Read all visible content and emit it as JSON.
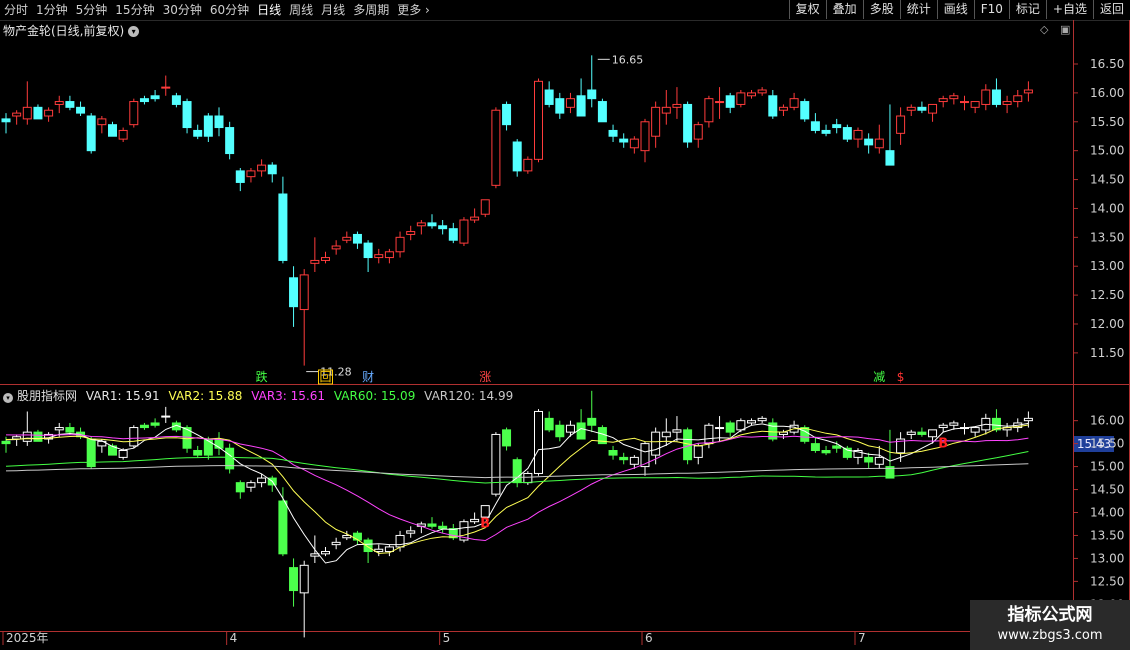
{
  "toolbar": {
    "periods": [
      "分时",
      "1分钟",
      "5分钟",
      "15分钟",
      "30分钟",
      "60分钟",
      "日线",
      "周线",
      "月线",
      "多周期"
    ],
    "active_period": "日线",
    "more": "更多",
    "tools": [
      "复权",
      "叠加",
      "多股",
      "统计",
      "画线",
      "F10",
      "标记",
      "+自选",
      "返回"
    ]
  },
  "stock": {
    "title": "物产金轮(日线,前复权)"
  },
  "indicator": {
    "name": "股朋指标网",
    "var1_label": "VAR1: 15.91",
    "var2_label": "VAR2: 15.88",
    "var3_label": "VAR3: 15.61",
    "var60_label": "VAR60: 15.09",
    "var120_label": "VAR120: 14.99",
    "current_price_tag": "15.43"
  },
  "colors": {
    "up": "#ff3c3c",
    "down": "#54ffff",
    "ind_up": "#ffffff",
    "ind_down": "#4cff4c",
    "var1": "#ffffff",
    "var2": "#ffff55",
    "var3": "#ff44ff",
    "var60": "#44ff44",
    "var120": "#c8c8c8",
    "axis": "#b03030",
    "signal": "#ff2020"
  },
  "watermark": {
    "title": "指标公式网",
    "url": "www.zbgs3.com"
  },
  "chart_data": [
    {
      "type": "candlestick",
      "title": "物产金轮(日线,前复权)",
      "y_ticks": [
        16.5,
        16.0,
        15.5,
        15.0,
        14.5,
        14.0,
        13.5,
        13.0,
        12.5,
        12.0,
        11.5
      ],
      "ylim": [
        11.1,
        16.95
      ],
      "annotations": {
        "high_label": "16.65",
        "low_label": "11.28"
      },
      "event_markers": [
        {
          "index": 24,
          "label": "跌",
          "color": "#44ff44"
        },
        {
          "index": 30,
          "label": "回",
          "color": "#ffcc00",
          "boxed": true
        },
        {
          "index": 34,
          "label": "财",
          "color": "#66aaff"
        },
        {
          "index": 45,
          "label": "涨",
          "color": "#ff4444"
        },
        {
          "index": 82,
          "label": "减",
          "color": "#44ff44"
        },
        {
          "index": 84,
          "label": "$",
          "color": "#ff3333"
        }
      ],
      "candles": [
        [
          15.55,
          15.65,
          15.3,
          15.5
        ],
        [
          15.6,
          15.7,
          15.45,
          15.65
        ],
        [
          15.55,
          16.2,
          15.45,
          15.75
        ],
        [
          15.75,
          15.8,
          15.55,
          15.55
        ],
        [
          15.6,
          15.75,
          15.5,
          15.7
        ],
        [
          15.8,
          15.95,
          15.65,
          15.85
        ],
        [
          15.85,
          15.95,
          15.7,
          15.75
        ],
        [
          15.75,
          15.85,
          15.6,
          15.65
        ],
        [
          15.6,
          15.65,
          14.95,
          15.0
        ],
        [
          15.45,
          15.6,
          15.3,
          15.55
        ],
        [
          15.45,
          15.5,
          15.25,
          15.25
        ],
        [
          15.2,
          15.4,
          15.15,
          15.35
        ],
        [
          15.45,
          15.9,
          15.4,
          15.85
        ],
        [
          15.9,
          15.95,
          15.8,
          15.85
        ],
        [
          15.95,
          16.05,
          15.85,
          15.9
        ],
        [
          16.1,
          16.3,
          15.95,
          16.1
        ],
        [
          15.95,
          16.0,
          15.75,
          15.8
        ],
        [
          15.85,
          15.9,
          15.3,
          15.4
        ],
        [
          15.35,
          15.45,
          15.2,
          15.25
        ],
        [
          15.6,
          15.65,
          15.15,
          15.25
        ],
        [
          15.6,
          15.75,
          15.25,
          15.4
        ],
        [
          15.4,
          15.5,
          14.85,
          14.95
        ],
        [
          14.65,
          14.7,
          14.3,
          14.45
        ],
        [
          14.55,
          14.7,
          14.45,
          14.65
        ],
        [
          14.65,
          14.85,
          14.55,
          14.75
        ],
        [
          14.75,
          14.8,
          14.45,
          14.6
        ],
        [
          14.25,
          14.55,
          13.05,
          13.1
        ],
        [
          12.8,
          13.0,
          11.95,
          12.3
        ],
        [
          12.25,
          12.95,
          11.28,
          12.85
        ],
        [
          13.05,
          13.5,
          12.9,
          13.1
        ],
        [
          13.1,
          13.25,
          13.05,
          13.15
        ],
        [
          13.3,
          13.45,
          13.2,
          13.35
        ],
        [
          13.45,
          13.6,
          13.4,
          13.5
        ],
        [
          13.55,
          13.6,
          13.3,
          13.4
        ],
        [
          13.4,
          13.45,
          12.9,
          13.15
        ],
        [
          13.15,
          13.3,
          13.05,
          13.2
        ],
        [
          13.15,
          13.3,
          13.05,
          13.25
        ],
        [
          13.25,
          13.6,
          13.15,
          13.5
        ],
        [
          13.55,
          13.7,
          13.45,
          13.6
        ],
        [
          13.7,
          13.8,
          13.55,
          13.75
        ],
        [
          13.75,
          13.9,
          13.65,
          13.7
        ],
        [
          13.7,
          13.8,
          13.55,
          13.65
        ],
        [
          13.65,
          13.75,
          13.4,
          13.45
        ],
        [
          13.4,
          13.85,
          13.35,
          13.8
        ],
        [
          13.8,
          14.0,
          13.75,
          13.85
        ],
        [
          13.9,
          14.15,
          13.85,
          14.15
        ],
        [
          14.4,
          15.75,
          14.35,
          15.7
        ],
        [
          15.8,
          15.85,
          15.35,
          15.45
        ],
        [
          15.15,
          15.2,
          14.55,
          14.65
        ],
        [
          14.65,
          14.9,
          14.6,
          14.85
        ],
        [
          14.85,
          16.25,
          14.8,
          16.2
        ],
        [
          16.05,
          16.2,
          15.75,
          15.8
        ],
        [
          15.9,
          16.0,
          15.55,
          15.65
        ],
        [
          15.75,
          16.0,
          15.65,
          15.9
        ],
        [
          15.95,
          16.25,
          15.7,
          15.6
        ],
        [
          16.05,
          16.65,
          15.75,
          15.9
        ],
        [
          15.85,
          15.9,
          15.55,
          15.5
        ],
        [
          15.35,
          15.45,
          15.15,
          15.25
        ],
        [
          15.2,
          15.3,
          15.05,
          15.15
        ],
        [
          15.05,
          15.25,
          14.95,
          15.2
        ],
        [
          15.0,
          15.55,
          14.8,
          15.5
        ],
        [
          15.25,
          15.85,
          15.05,
          15.75
        ],
        [
          15.65,
          16.05,
          15.45,
          15.75
        ],
        [
          15.75,
          16.1,
          15.55,
          15.8
        ],
        [
          15.8,
          15.85,
          15.05,
          15.15
        ],
        [
          15.2,
          15.5,
          15.05,
          15.45
        ],
        [
          15.5,
          15.95,
          15.4,
          15.9
        ],
        [
          15.85,
          16.1,
          15.55,
          15.85
        ],
        [
          15.95,
          16.0,
          15.65,
          15.75
        ],
        [
          15.8,
          16.05,
          15.75,
          16.0
        ],
        [
          15.95,
          16.05,
          15.9,
          16.0
        ],
        [
          16.0,
          16.1,
          15.95,
          16.05
        ],
        [
          15.95,
          16.05,
          15.55,
          15.6
        ],
        [
          15.7,
          15.8,
          15.6,
          15.75
        ],
        [
          15.75,
          16.0,
          15.7,
          15.9
        ],
        [
          15.85,
          15.9,
          15.5,
          15.55
        ],
        [
          15.5,
          15.65,
          15.3,
          15.35
        ],
        [
          15.35,
          15.45,
          15.25,
          15.3
        ],
        [
          15.45,
          15.55,
          15.3,
          15.4
        ],
        [
          15.4,
          15.45,
          15.15,
          15.2
        ],
        [
          15.2,
          15.4,
          15.05,
          15.35
        ],
        [
          15.2,
          15.3,
          14.95,
          15.1
        ],
        [
          15.05,
          15.45,
          14.95,
          15.2
        ],
        [
          15.0,
          15.8,
          14.75,
          14.75
        ],
        [
          15.3,
          15.75,
          15.1,
          15.6
        ],
        [
          15.7,
          15.8,
          15.6,
          15.75
        ],
        [
          15.75,
          15.85,
          15.65,
          15.7
        ],
        [
          15.65,
          15.8,
          15.5,
          15.8
        ],
        [
          15.85,
          15.95,
          15.75,
          15.9
        ],
        [
          15.9,
          16.0,
          15.8,
          15.95
        ],
        [
          15.85,
          15.95,
          15.7,
          15.85
        ],
        [
          15.75,
          15.85,
          15.65,
          15.85
        ],
        [
          15.8,
          16.15,
          15.7,
          16.05
        ],
        [
          16.05,
          16.25,
          15.75,
          15.8
        ],
        [
          15.8,
          15.95,
          15.65,
          15.85
        ],
        [
          15.85,
          16.05,
          15.75,
          15.95
        ],
        [
          16.0,
          16.2,
          15.85,
          16.05
        ]
      ]
    },
    {
      "type": "line",
      "title": "股朋指标网",
      "y_ticks": [
        16.0,
        15.5,
        15.0,
        14.5,
        14.0,
        13.5,
        13.0,
        12.5,
        12.0
      ],
      "ylim": [
        11.55,
        16.45
      ],
      "series": [
        {
          "name": "VAR1"
        },
        {
          "name": "VAR2"
        },
        {
          "name": "VAR3"
        },
        {
          "name": "VAR60"
        },
        {
          "name": "VAR120"
        }
      ],
      "buy_signals": [
        {
          "index": 45,
          "label": "B"
        },
        {
          "index": 88,
          "label": "B"
        }
      ]
    }
  ],
  "date_axis": {
    "labels": [
      {
        "index": 0,
        "text": "2025年"
      },
      {
        "index": 21,
        "text": "4"
      },
      {
        "index": 41,
        "text": "5"
      },
      {
        "index": 60,
        "text": "6"
      },
      {
        "index": 80,
        "text": "7"
      }
    ]
  }
}
